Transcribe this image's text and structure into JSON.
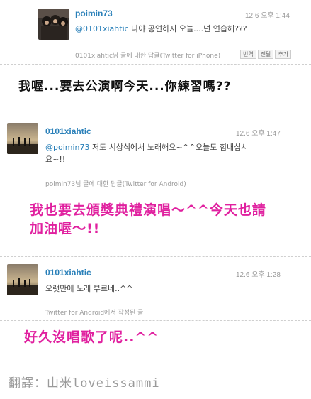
{
  "tweets": [
    {
      "username": "poimin73",
      "time": "12.6 오후 1:44",
      "mention": "@0101xiahtic",
      "text": " 나야 공연하지 오늘....넌 연습해???",
      "meta": "0101xiahtic님 글에 대한 답글(Twitter for iPhone)",
      "buttons": [
        "번역",
        "전달",
        "추가"
      ]
    },
    {
      "username": "0101xiahtic",
      "time": "12.6 오후 1:47",
      "mention": "@poimin73",
      "text_line1": " 저도 시상식에서 노래해요~^^오늘도 힘내십시",
      "text_line2": "요~!!",
      "meta": "poimin73님 글에 대한 답글(Twitter for Android)"
    },
    {
      "username": "0101xiahtic",
      "time": "12.6 오후 1:28",
      "text": "오랫만에 노래 부르네..^^",
      "meta": "Twitter for Android에서 작성된 글"
    }
  ],
  "captions": {
    "caption1": "我喔...要去公演啊今天...你練習嗎??",
    "caption2_line1": "我也要去頒獎典禮演唱～^^今天也請",
    "caption2_line2": "加油喔～!!",
    "caption3": "好久沒唱歌了呢..^^"
  },
  "translator": "翻譯：山米loveissammi"
}
